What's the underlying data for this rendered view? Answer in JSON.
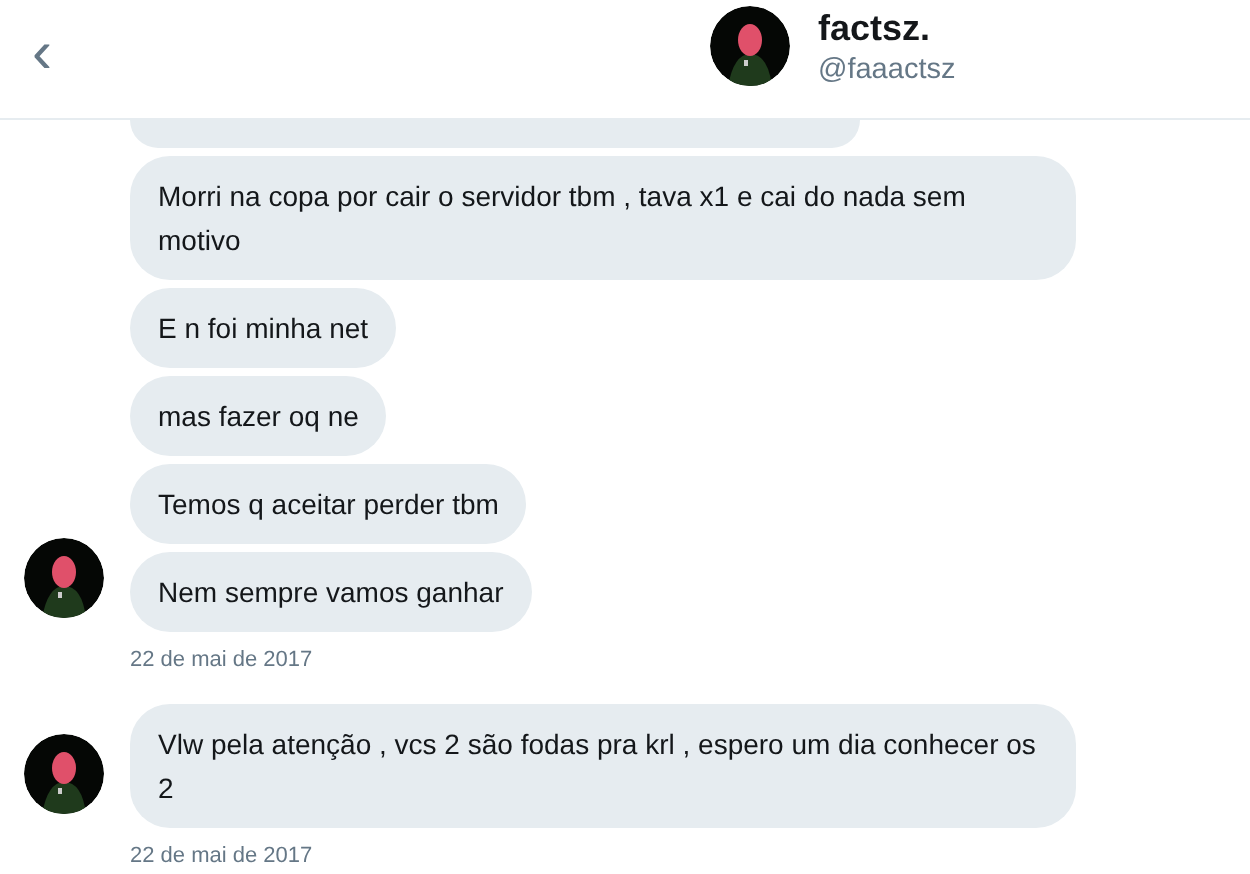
{
  "header": {
    "back": "‹",
    "name": "factsz.",
    "handle": "@faaactsz"
  },
  "groups": [
    {
      "messages": [
        "Morri na copa por cair o servidor tbm , tava x1 e cai do nada sem motivo",
        "E n foi minha net",
        "mas fazer oq ne",
        "Temos q aceitar perder tbm",
        "Nem sempre vamos ganhar"
      ],
      "timestamp": "22 de mai de 2017"
    },
    {
      "messages": [
        "Vlw pela atenção , vcs 2 são fodas pra krl , espero um dia conhecer os 2"
      ],
      "timestamp": "22 de mai de 2017"
    }
  ]
}
